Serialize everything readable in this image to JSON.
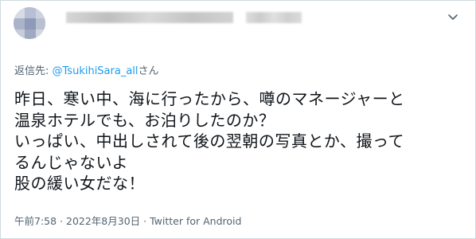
{
  "tweet": {
    "reply_prefix": "返信先: ",
    "reply_mention": "@TsukihiSara_all",
    "reply_suffix": "さん",
    "lines": [
      "昨日、寒い中、海に行ったから、噂のマネージャーと",
      "温泉ホテルでも、お泊りしたのか？",
      "いっぱい、中出しされて後の翌朝の写真とか、撮って",
      "るんじゃないよ",
      "股の緩い女だな！"
    ],
    "time": "午前7:58",
    "separator1": " · ",
    "date": "2022年8月30日",
    "separator2": " · ",
    "source": "Twitter for Android"
  },
  "icons": {
    "avatar": "pixelated-avatar",
    "more": "chevron-down-icon"
  },
  "colors": {
    "text": "#0f1419",
    "muted": "#536471",
    "link": "#1d9bf0",
    "border": "#cfd9de"
  }
}
